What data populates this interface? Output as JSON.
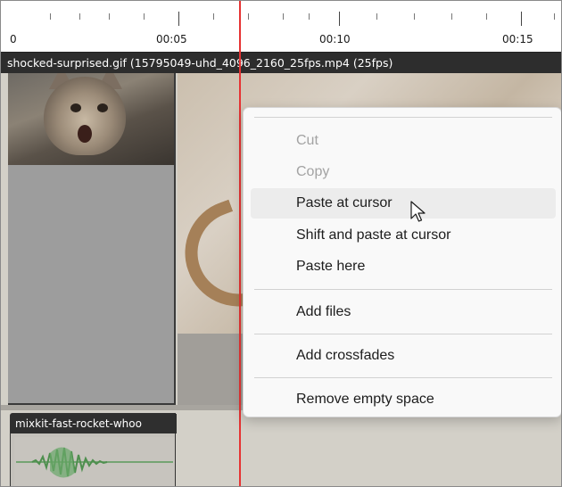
{
  "ruler": {
    "labels": [
      "0",
      "00:05",
      "00:10",
      "00:15"
    ]
  },
  "video_track": {
    "clip_header": "shocked-surprised.gif (15795049-uhd_4096_2160_25fps.mp4 (25fps)"
  },
  "audio_track": {
    "clip_label": "mixkit-fast-rocket-whoo"
  },
  "context_menu": {
    "items": [
      {
        "label": "Cut",
        "enabled": false
      },
      {
        "label": "Copy",
        "enabled": false
      },
      {
        "label": "Paste at cursor",
        "enabled": true,
        "highlighted": true
      },
      {
        "label": "Shift and paste at cursor",
        "enabled": true
      },
      {
        "label": "Paste here",
        "enabled": true
      },
      {
        "label": "Add files",
        "enabled": true
      },
      {
        "label": "Add crossfades",
        "enabled": true
      },
      {
        "label": "Remove empty space",
        "enabled": true
      }
    ]
  },
  "colors": {
    "playhead": "#e63333",
    "clip_header_bg": "#2d2d2d",
    "waveform": "#5a9a5a",
    "menu_bg": "#f9f9f9",
    "menu_highlight": "#ececec",
    "menu_disabled_text": "#a3a3a3"
  },
  "icons": {
    "cursor": "mouse-pointer-icon",
    "waveform": "audio-waveform-icon"
  }
}
